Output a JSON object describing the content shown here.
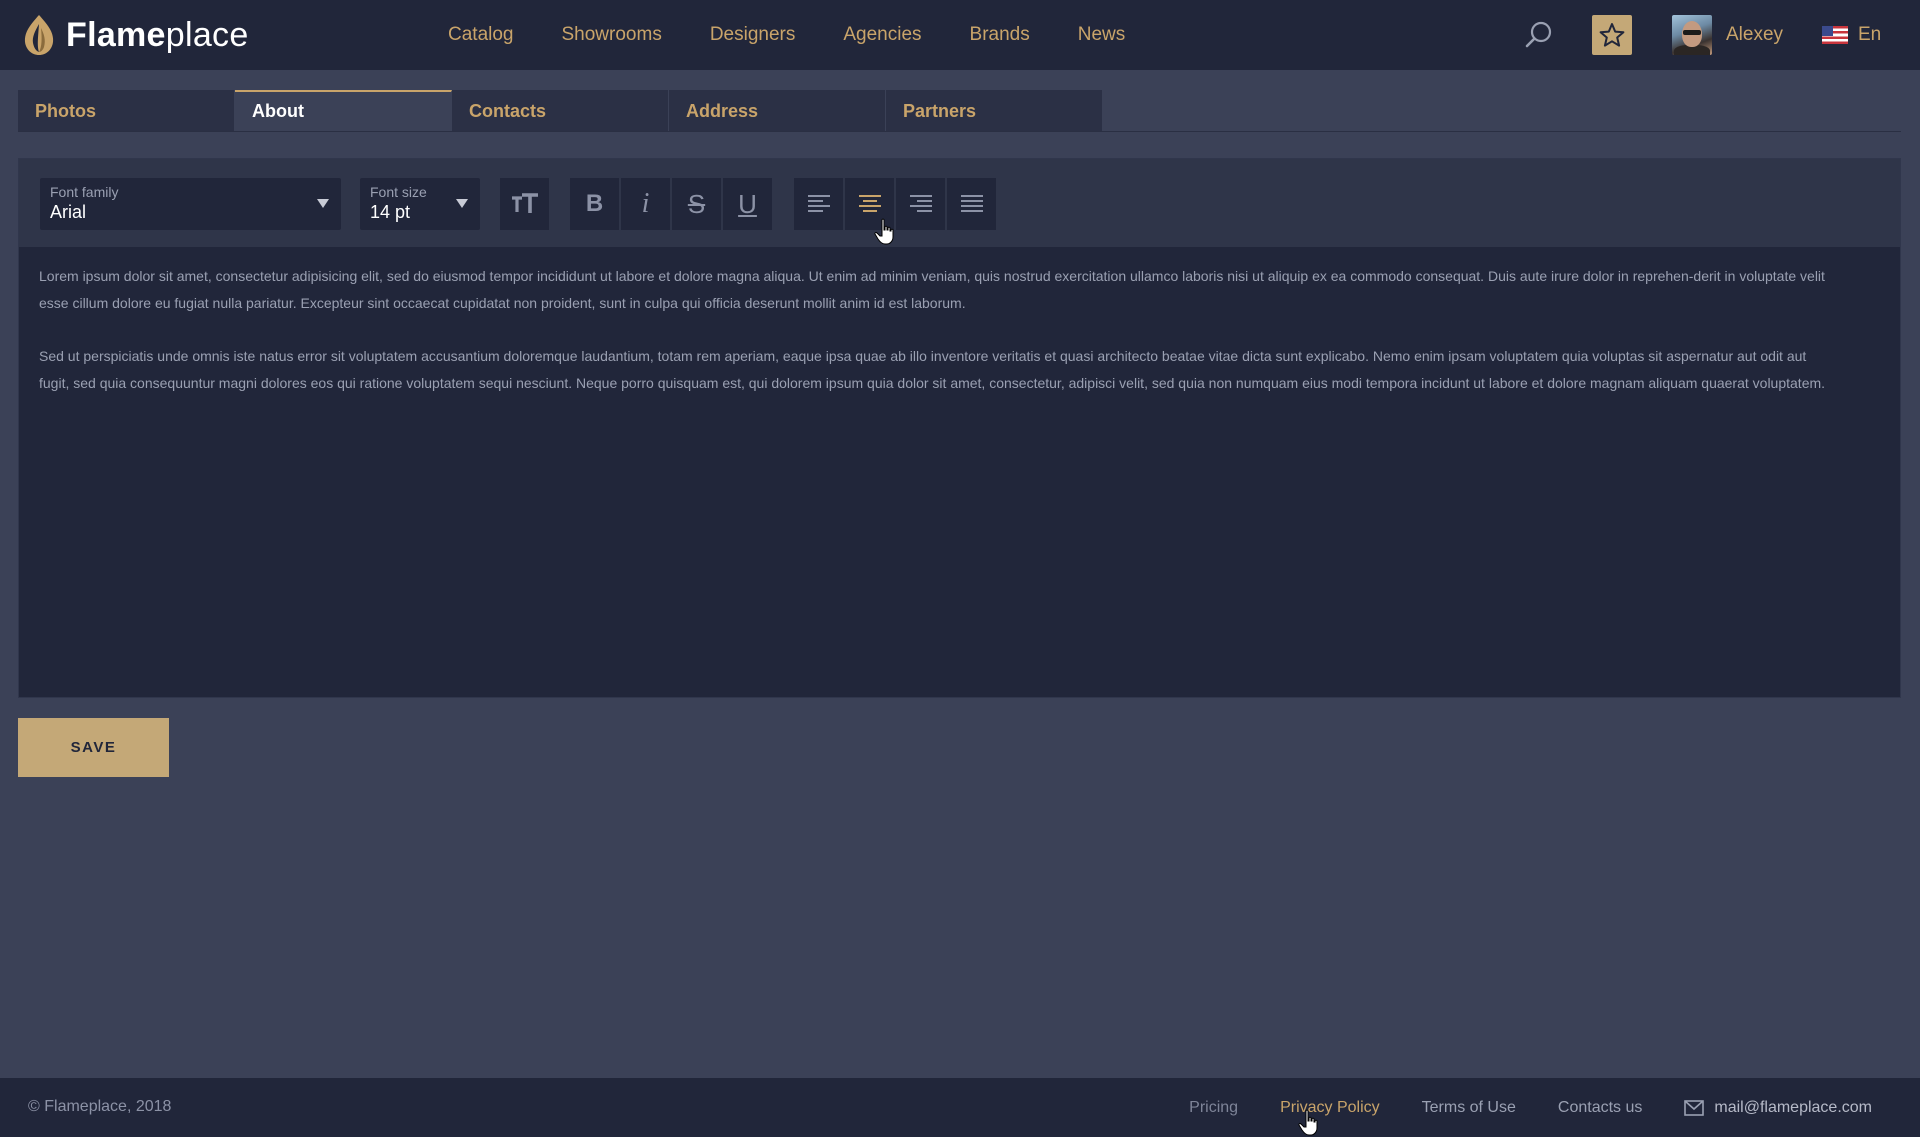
{
  "header": {
    "logo_bold": "Flame",
    "logo_light": "place",
    "nav": [
      "Catalog",
      "Showrooms",
      "Designers",
      "Agencies",
      "Brands",
      "News"
    ],
    "user_name": "Alexey",
    "language": "En"
  },
  "tabs": [
    {
      "label": "Photos",
      "active": false
    },
    {
      "label": "About",
      "active": true
    },
    {
      "label": "Contacts",
      "active": false
    },
    {
      "label": "Address",
      "active": false
    },
    {
      "label": "Partners",
      "active": false
    }
  ],
  "editor": {
    "font_family_label": "Font family",
    "font_family_value": "Arial",
    "font_size_label": "Font size",
    "font_size_value": "14 pt",
    "paragraphs": [
      "Lorem ipsum dolor sit amet, consectetur adipisicing elit, sed do eiusmod tempor incididunt ut labore et dolore magna aliqua. Ut enim ad minim veniam, quis nostrud exercitation ullamco laboris nisi ut aliquip ex ea commodo consequat. Duis aute irure dolor in reprehen-derit in voluptate velit esse cillum dolore eu fugiat nulla pariatur. Excepteur sint occaecat cupidatat non proident, sunt in culpa qui officia deserunt mollit anim id est laborum.",
      "Sed ut perspiciatis unde omnis iste natus error sit voluptatem accusantium doloremque laudantium, totam rem aperiam, eaque ipsa quae ab illo inventore veritatis et quasi architecto beatae vitae dicta sunt explicabo. Nemo enim ipsam voluptatem quia voluptas sit aspernatur aut odit aut fugit, sed quia consequuntur magni dolores eos qui ratione voluptatem sequi nesciunt. Neque porro quisquam est, qui dolorem ipsum quia dolor sit amet, consectetur, adipisci velit, sed quia non numquam eius modi tempora incidunt ut labore et dolore magnam aliquam quaerat voluptatem."
    ],
    "active_alignment": "center"
  },
  "save_label": "SAVE",
  "footer": {
    "copyright": "© Flameplace, 2018",
    "links": [
      "Pricing",
      "Privacy Policy",
      "Terms of Use",
      "Contacts us"
    ],
    "email": "mail@flameplace.com"
  },
  "colors": {
    "accent": "#c9a46a",
    "header_bg": "#21263a",
    "page_bg": "#3b4157"
  },
  "icons": [
    "flame-logo-icon",
    "search-icon",
    "star-icon",
    "us-flag-icon",
    "text-size-icon",
    "bold-icon",
    "italic-icon",
    "strikethrough-icon",
    "underline-icon",
    "align-left-icon",
    "align-center-icon",
    "align-right-icon",
    "align-justify-icon",
    "mail-icon"
  ]
}
